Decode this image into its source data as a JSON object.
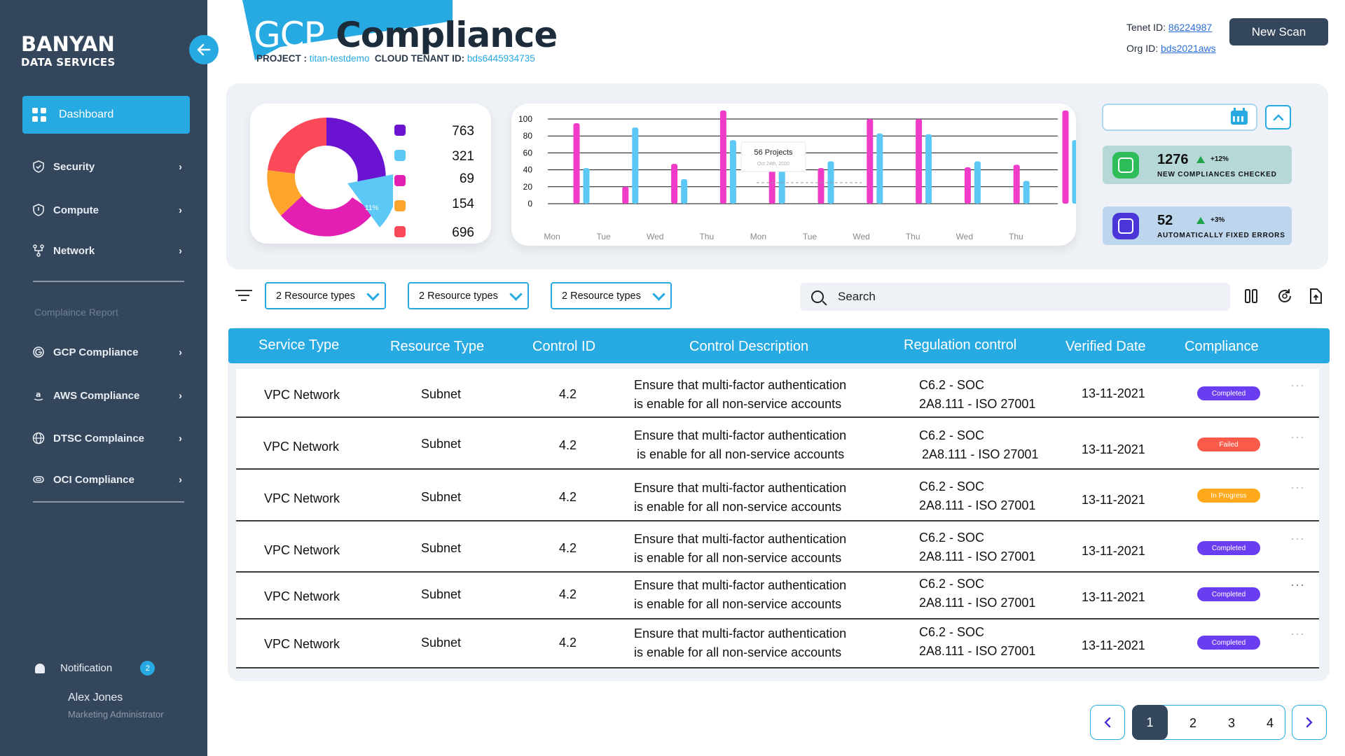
{
  "brand": {
    "line1": "BANYAN",
    "line2": "DATA SERVICES"
  },
  "sidebar": {
    "dashboard": "Dashboard",
    "items": [
      {
        "label": "Security",
        "icon": "shield-check-icon"
      },
      {
        "label": "Compute",
        "icon": "shield-icon"
      },
      {
        "label": "Network",
        "icon": "network-icon"
      }
    ],
    "section_title": "Complaince Report",
    "reports": [
      {
        "label": "GCP Compliance",
        "icon": "google-icon"
      },
      {
        "label": "AWS Compliance",
        "icon": "amazon-icon"
      },
      {
        "label": "DTSC Complaince",
        "icon": "globe-icon"
      },
      {
        "label": "OCI Compliance",
        "icon": "oci-icon"
      }
    ],
    "notification_label": "Notification",
    "notification_count": "2",
    "user_name": "Alex Jones",
    "user_role": "Marketing Administrator"
  },
  "header": {
    "title_part1": "GCP",
    "title_part2": "Compliance",
    "project_label": "PROJECT :",
    "project_value": "titan-testdemo",
    "tenant_label": "CLOUD TENANT ID:",
    "tenant_value": "bds6445934735",
    "tenet_id_label": "Tenet ID:",
    "tenet_id_value": "86224987",
    "org_id_label": "Org ID:",
    "org_id_value": "bds2021aws",
    "new_scan": "New Scan"
  },
  "colors": {
    "purple": "#6a14d1",
    "cyan": "#5bc8f5",
    "magenta": "#e21fb2",
    "orange": "#ffa52d",
    "red": "#fa4a5a",
    "pink": "#f03bc8",
    "accent": "#27a9e1",
    "dark": "#34465b"
  },
  "donut": {
    "slice_label": "11%",
    "legend": [
      {
        "value": "763",
        "color": "#6a14d1"
      },
      {
        "value": "321",
        "color": "#5bc8f5"
      },
      {
        "value": "69",
        "color": "#e21fb2"
      },
      {
        "value": "154",
        "color": "#ffa52d"
      },
      {
        "value": "696",
        "color": "#fa4a5a"
      }
    ]
  },
  "chart_data": {
    "type": "bar",
    "categories": [
      "Mon",
      "Tue",
      "Wed",
      "Thu",
      "Mon",
      "Tue",
      "Wed",
      "Thu",
      "Wed",
      "Thu"
    ],
    "series": [
      {
        "color": "#f03bc8",
        "values": [
          95,
          20,
          47,
          110,
          57,
          42,
          100,
          100,
          43,
          46,
          110
        ]
      },
      {
        "color": "#5bc8f5",
        "values": [
          42,
          90,
          29,
          75,
          52,
          50,
          83,
          82,
          50,
          27,
          75
        ]
      }
    ],
    "ylim": [
      0,
      100
    ],
    "yticks": [
      0,
      20,
      40,
      60,
      80,
      100
    ],
    "tooltip": {
      "title": "56 Projects",
      "subtitle": "Oct 24th, 2020"
    }
  },
  "stats": [
    {
      "value": "1276",
      "change": "+12%",
      "label": "NEW COMPLIANCES CHECKED",
      "bg": "#b6d9d8",
      "icon_bg": "#2fbd5a",
      "icon": "chart-icon"
    },
    {
      "value": "52",
      "change": "+3%",
      "label": "AUTOMATICALLY FIXED ERRORS",
      "bg": "#bdd6ee",
      "icon_bg": "#4a35d8",
      "icon": "chart-icon"
    }
  ],
  "filters": [
    "2 Resource types",
    "2 Resource types",
    "2 Resource types"
  ],
  "search": {
    "placeholder": "Search"
  },
  "table": {
    "headers": [
      "Service Type",
      "Resource Type",
      "Control ID",
      "Control Description",
      "Regulation control",
      "Verified Date",
      "Compliance"
    ],
    "rows": [
      {
        "service": "VPC Network",
        "resource": "Subnet",
        "control_id": "4.2",
        "desc1": "Ensure that multi-factor authentication",
        "desc2": "is enable for all non-service accounts",
        "reg1": "C6.2 - SOC",
        "reg2": "2A8.111 - ISO 27001",
        "date": "13-11-2021",
        "status": "Completed",
        "status_color": "#6a3ef0"
      },
      {
        "service": "VPC Network",
        "resource": "Subnet",
        "control_id": "4.2",
        "desc1": "Ensure that multi-factor authentication",
        "desc2": "is enable for all non-service accounts",
        "reg1": "C6.2 - SOC",
        "reg2": "2A8.111 - ISO 27001",
        "date": "13-11-2021",
        "status": "Failed",
        "status_color": "#fa5a4a"
      },
      {
        "service": "VPC Network",
        "resource": "Subnet",
        "control_id": "4.2",
        "desc1": "Ensure that multi-factor authentication",
        "desc2": "is enable for all non-service accounts",
        "reg1": "C6.2 - SOC",
        "reg2": "2A8.111 - ISO 27001",
        "date": "13-11-2021",
        "status": "In Progress",
        "status_color": "#ffa91a"
      },
      {
        "service": "VPC Network",
        "resource": "Subnet",
        "control_id": "4.2",
        "desc1": "Ensure that multi-factor authentication",
        "desc2": "is enable for all non-service accounts",
        "reg1": "C6.2 - SOC",
        "reg2": "2A8.111 - ISO 27001",
        "date": "13-11-2021",
        "status": "Completed",
        "status_color": "#6a3ef0"
      },
      {
        "service": "VPC Network",
        "resource": "Subnet",
        "control_id": "4.2",
        "desc1": "Ensure that multi-factor authentication",
        "desc2": "is enable for all non-service accounts",
        "reg1": "C6.2 - SOC",
        "reg2": "2A8.111 - ISO 27001",
        "date": "13-11-2021",
        "status": "Completed",
        "status_color": "#6a3ef0"
      },
      {
        "service": "VPC Network",
        "resource": "Subnet",
        "control_id": "4.2",
        "desc1": "Ensure that multi-factor authentication",
        "desc2": "is enable for all non-service accounts",
        "reg1": "C6.2 - SOC",
        "reg2": "2A8.111 - ISO 27001",
        "date": "13-11-2021",
        "status": "Completed",
        "status_color": "#6a3ef0"
      }
    ]
  },
  "pagination": {
    "pages": [
      "1",
      "2",
      "3",
      "4"
    ],
    "active": "1"
  }
}
